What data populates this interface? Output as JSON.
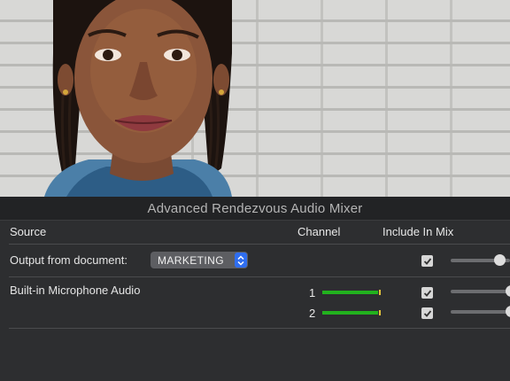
{
  "mixer": {
    "title": "Advanced Rendezvous Audio Mixer",
    "headers": {
      "source": "Source",
      "channel": "Channel",
      "include": "Include In Mix"
    },
    "rows": [
      {
        "source": "Output from document:",
        "document_select": "MARKETING",
        "include": true,
        "volume": 0.8
      },
      {
        "source": "Built-in Microphone Audio",
        "channels": [
          {
            "number": "1",
            "level": 0.95,
            "include": true,
            "volume": 0.9
          },
          {
            "number": "2",
            "level": 0.95,
            "include": true,
            "volume": 1.0
          }
        ]
      }
    ]
  },
  "colors": {
    "meter_green": "#22b21e",
    "select_accent": "#2f6ef0"
  },
  "icons": {
    "select_arrows": "updown-chevron-icon",
    "checkbox": "checkmark-icon"
  }
}
